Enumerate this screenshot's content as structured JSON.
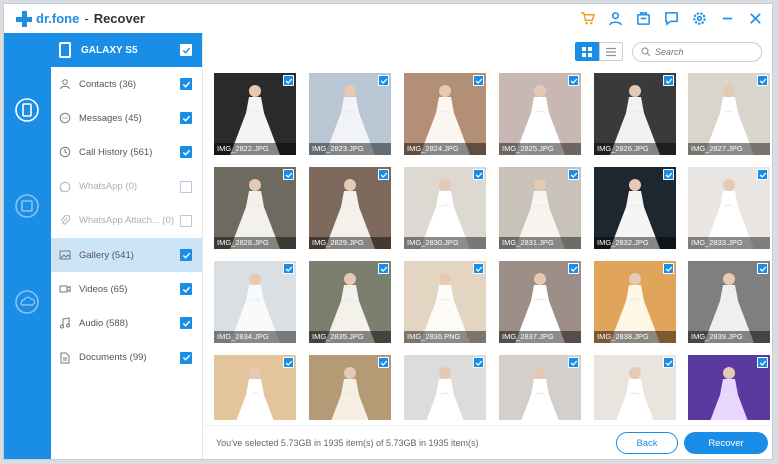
{
  "app": {
    "brand": "dr.fone",
    "separator": "-",
    "title": "Recover"
  },
  "title_icons": [
    "cart-icon",
    "account-icon",
    "store-icon",
    "feedback-icon",
    "settings-icon",
    "minimize-icon",
    "close-icon"
  ],
  "rail": [
    "phone-recover-icon",
    "itunes-recover-icon",
    "icloud-recover-icon"
  ],
  "device": {
    "name": "GALAXY S5",
    "checked": true
  },
  "categories": [
    {
      "label": "Contacts (36)",
      "icon": "contacts-icon",
      "checked": true,
      "disabled": false,
      "selected": false
    },
    {
      "label": "Messages (45)",
      "icon": "messages-icon",
      "checked": true,
      "disabled": false,
      "selected": false
    },
    {
      "label": "Call History (561)",
      "icon": "call-history-icon",
      "checked": true,
      "disabled": false,
      "selected": false
    },
    {
      "label": "WhatsApp (0)",
      "icon": "whatsapp-icon",
      "checked": false,
      "disabled": true,
      "selected": false
    },
    {
      "label": "WhatsApp Attach...  (0)",
      "icon": "attachment-icon",
      "checked": false,
      "disabled": true,
      "selected": false
    },
    {
      "label": "Gallery (541)",
      "icon": "gallery-icon",
      "checked": true,
      "disabled": false,
      "selected": true
    },
    {
      "label": "Videos (65)",
      "icon": "videos-icon",
      "checked": true,
      "disabled": false,
      "selected": false
    },
    {
      "label": "Audio (588)",
      "icon": "audio-icon",
      "checked": true,
      "disabled": false,
      "selected": false
    },
    {
      "label": "Documents (99)",
      "icon": "documents-icon",
      "checked": true,
      "disabled": false,
      "selected": false
    }
  ],
  "search": {
    "placeholder": "Search"
  },
  "photos": [
    "IMG_2822.JPG",
    "IMG_2823.JPG",
    "IMG_2824.JPG",
    "IMG_2825.JPG",
    "IMG_2826.JPG",
    "IMG_2827.JPG",
    "IMG_2828.JPG",
    "IMG_2829.JPG",
    "IMG_2830.JPG",
    "IMG_2831.JPG",
    "IMG_2832.JPG",
    "IMG_2833.JPG",
    "IMG_2834.JPG",
    "IMG_2835.JPG",
    "IMG_2836.PNG",
    "IMG_2837.JPG",
    "IMG_2838.JPG",
    "IMG_2839.JPG",
    "",
    "",
    "",
    "",
    "",
    ""
  ],
  "photo_palettes": [
    [
      "#2b2b2b",
      "#f4f4f4"
    ],
    [
      "#b9c7d4",
      "#f1f3f6"
    ],
    [
      "#b28f75",
      "#fbf6f0"
    ],
    [
      "#c9b7b3",
      "#ffffff"
    ],
    [
      "#3a3a3a",
      "#f2f2f2"
    ],
    [
      "#d9d4cc",
      "#ffffff"
    ],
    [
      "#6f6a60",
      "#f3f1ec"
    ],
    [
      "#7d6a5c",
      "#f5f0ea"
    ],
    [
      "#ddd8d2",
      "#ffffff"
    ],
    [
      "#c9c2b8",
      "#f8f5f1"
    ],
    [
      "#1e2730",
      "#f5f5f5"
    ],
    [
      "#e8e5e2",
      "#ffffff"
    ],
    [
      "#d9dfe3",
      "#fafafa"
    ],
    [
      "#7a7f6e",
      "#f3f1ea"
    ],
    [
      "#e4d5c2",
      "#fdfbf7"
    ],
    [
      "#9c8d86",
      "#ffffff"
    ],
    [
      "#e0a55a",
      "#fff6e6"
    ],
    [
      "#7f7f7f",
      "#efefef"
    ],
    [
      "#e2c59a",
      "#ffffff"
    ],
    [
      "#b59a76",
      "#f7efe3"
    ],
    [
      "#dcdcdc",
      "#ffffff"
    ],
    [
      "#d3d0cc",
      "#ffffff"
    ],
    [
      "#e9e4de",
      "#ffffff"
    ],
    [
      "#5b3aa0",
      "#e9d6ff"
    ]
  ],
  "footer": {
    "status": "You've selected 5.73GB in 1935 item(s) of 5.73GB in 1935 item(s)",
    "back_label": "Back",
    "recover_label": "Recover"
  },
  "accent": "#1a8ee6"
}
